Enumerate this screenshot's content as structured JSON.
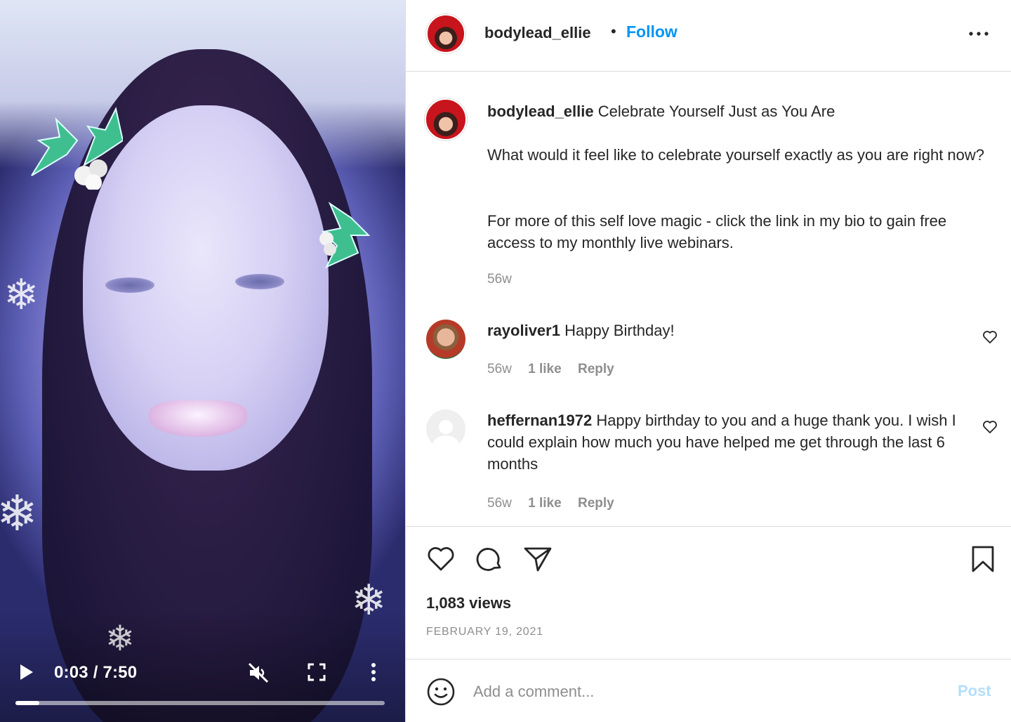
{
  "video": {
    "current_time": "0:03",
    "duration": "7:50",
    "time_display": "0:03 / 7:50",
    "progress_fraction": 0.064,
    "icons": {
      "play": "play-icon",
      "mute": "muted-speaker-icon",
      "fullscreen": "fullscreen-icon",
      "more": "vertical-ellipsis-icon"
    }
  },
  "header": {
    "username": "bodylead_ellie",
    "separator": "•",
    "follow_label": "Follow",
    "more_icon": "horizontal-ellipsis-icon"
  },
  "caption": {
    "username": "bodylead_ellie",
    "title": "Celebrate Yourself Just as You Are",
    "paragraph1": "What would it feel like to celebrate yourself exactly as you are right now?",
    "paragraph2": "For more of this self love magic - click the link in my bio to gain free access to my monthly live webinars.",
    "age": "56w"
  },
  "comments": [
    {
      "username": "rayoliver1",
      "text": "Happy Birthday!",
      "age": "56w",
      "likes": "1 like",
      "reply_label": "Reply"
    },
    {
      "username": "heffernan1972",
      "text": "Happy birthday to you and a huge thank you. I wish I could explain how much you have helped me get through the last 6 months",
      "age": "56w",
      "likes": "1 like",
      "reply_label": "Reply"
    }
  ],
  "actions": {
    "like_icon": "heart-icon",
    "comment_icon": "comment-bubble-icon",
    "share_icon": "paper-plane-icon",
    "save_icon": "bookmark-icon"
  },
  "stats": {
    "views": "1,083 views",
    "date": "FEBRUARY 19, 2021"
  },
  "add_comment": {
    "placeholder": "Add a comment...",
    "post_label": "Post",
    "emoji_icon": "smiley-icon"
  },
  "colors": {
    "accent": "#0095f6",
    "post_disabled": "#b2dffc",
    "muted_text": "#8e8e8e",
    "divider": "#dbdbdb"
  }
}
